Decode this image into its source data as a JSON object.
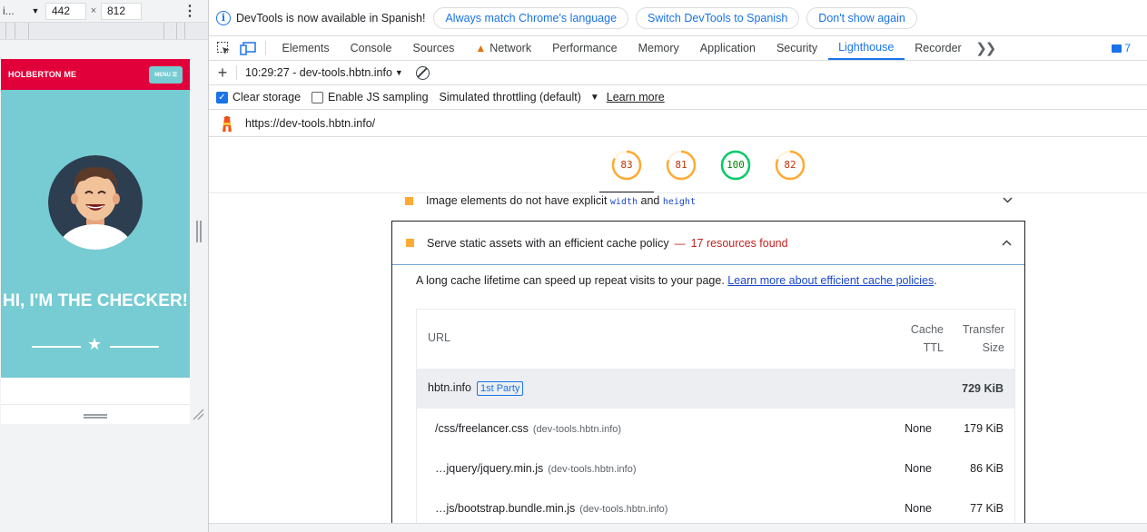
{
  "device_toolbar": {
    "device_label": "i...",
    "width_value": "442",
    "height_value": "812",
    "times": "×"
  },
  "site": {
    "brand": "HOLBERTON ME",
    "menu_label": "MENU ☰",
    "hero_title": "HI, I'M THE CHECKER!",
    "colors": {
      "nav": "#e1003a",
      "hero": "#76ccd2"
    }
  },
  "infobar": {
    "message": "DevTools is now available in Spanish!",
    "buttons": [
      "Always match Chrome's language",
      "Switch DevTools to Spanish",
      "Don't show again"
    ]
  },
  "tabs": [
    "Elements",
    "Console",
    "Sources",
    "Network",
    "Performance",
    "Memory",
    "Application",
    "Security",
    "Lighthouse",
    "Recorder"
  ],
  "active_tab": "Lighthouse",
  "issues_count": "7",
  "lighthouse": {
    "report_label": "10:29:27 - dev-tools.hbtn.info",
    "settings": {
      "clear_storage": "Clear storage",
      "clear_storage_checked": true,
      "js_sampling": "Enable JS sampling",
      "js_sampling_checked": false,
      "throttling": "Simulated throttling (default)",
      "learn_more": "Learn more"
    },
    "url": "https://dev-tools.hbtn.info/",
    "scores": [
      {
        "value": "83",
        "color": "#fa3"
      },
      {
        "value": "81",
        "color": "#fa3"
      },
      {
        "value": "100",
        "color": "#0c6"
      },
      {
        "value": "82",
        "color": "#fa3"
      }
    ],
    "collapsed_audit": {
      "title_start": "Image elements do not have explicit",
      "code1": "width",
      "and": "and",
      "code2": "height"
    },
    "open_audit": {
      "title": "Serve static assets with an efficient cache policy",
      "dash": "—",
      "display_value": "17 resources found",
      "description": "A long cache lifetime can speed up repeat visits to your page.",
      "description_link": "Learn more about efficient cache policies",
      "table": {
        "headers": {
          "url": "URL",
          "ttl_1": "Cache",
          "ttl_2": "TTL",
          "size_1": "Transfer",
          "size_2": "Size"
        },
        "group": {
          "name": "hbtn.info",
          "badge": "1st Party",
          "size": "729 KiB"
        },
        "rows": [
          {
            "url": "/css/freelancer.css",
            "host": "(dev-tools.hbtn.info)",
            "ttl": "None",
            "size": "179 KiB"
          },
          {
            "url": "…jquery/jquery.min.js",
            "host": "(dev-tools.hbtn.info)",
            "ttl": "None",
            "size": "86 KiB"
          },
          {
            "url": "…js/bootstrap.bundle.min.js",
            "host": "(dev-tools.hbtn.info)",
            "ttl": "None",
            "size": "77 KiB"
          }
        ]
      }
    }
  }
}
